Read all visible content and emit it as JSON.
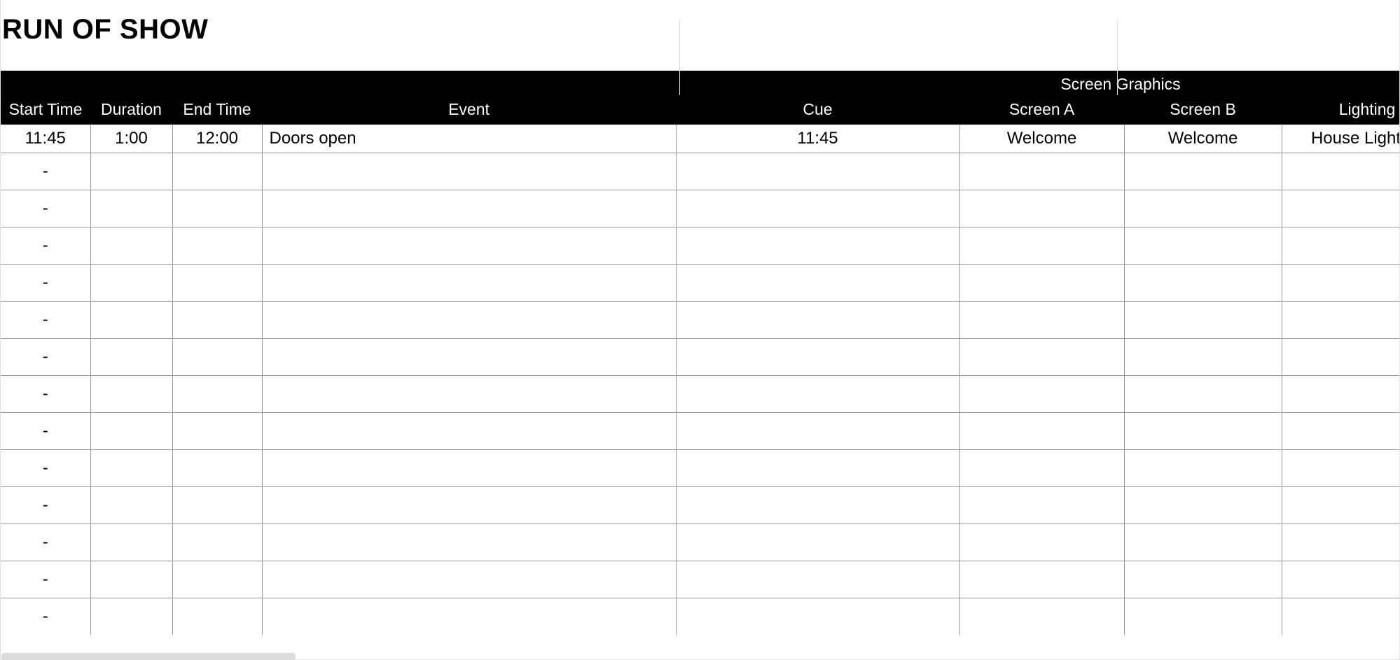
{
  "title": "RUN OF SHOW",
  "headers": {
    "group_screen_graphics": "Screen Graphics",
    "start_time": "Start Time",
    "duration": "Duration",
    "end_time": "End Time",
    "event": "Event",
    "cue": "Cue",
    "screen_a": "Screen A",
    "screen_b": "Screen B",
    "lighting": "Lighting"
  },
  "rows": [
    {
      "start": "11:45",
      "dur": "1:00",
      "end": "12:00",
      "event": "Doors open",
      "cue": "11:45",
      "scra": "Welcome",
      "scrb": "Welcome",
      "light": "House Lighting"
    },
    {
      "start": "-",
      "dur": "",
      "end": "",
      "event": "",
      "cue": "",
      "scra": "",
      "scrb": "",
      "light": ""
    },
    {
      "start": "-",
      "dur": "",
      "end": "",
      "event": "",
      "cue": "",
      "scra": "",
      "scrb": "",
      "light": ""
    },
    {
      "start": "-",
      "dur": "",
      "end": "",
      "event": "",
      "cue": "",
      "scra": "",
      "scrb": "",
      "light": ""
    },
    {
      "start": "-",
      "dur": "",
      "end": "",
      "event": "",
      "cue": "",
      "scra": "",
      "scrb": "",
      "light": ""
    },
    {
      "start": "-",
      "dur": "",
      "end": "",
      "event": "",
      "cue": "",
      "scra": "",
      "scrb": "",
      "light": ""
    },
    {
      "start": "-",
      "dur": "",
      "end": "",
      "event": "",
      "cue": "",
      "scra": "",
      "scrb": "",
      "light": ""
    },
    {
      "start": "-",
      "dur": "",
      "end": "",
      "event": "",
      "cue": "",
      "scra": "",
      "scrb": "",
      "light": ""
    },
    {
      "start": "-",
      "dur": "",
      "end": "",
      "event": "",
      "cue": "",
      "scra": "",
      "scrb": "",
      "light": ""
    },
    {
      "start": "-",
      "dur": "",
      "end": "",
      "event": "",
      "cue": "",
      "scra": "",
      "scrb": "",
      "light": ""
    },
    {
      "start": "-",
      "dur": "",
      "end": "",
      "event": "",
      "cue": "",
      "scra": "",
      "scrb": "",
      "light": ""
    },
    {
      "start": "-",
      "dur": "",
      "end": "",
      "event": "",
      "cue": "",
      "scra": "",
      "scrb": "",
      "light": ""
    },
    {
      "start": "-",
      "dur": "",
      "end": "",
      "event": "",
      "cue": "",
      "scra": "",
      "scrb": "",
      "light": ""
    },
    {
      "start": "-",
      "dur": "",
      "end": "",
      "event": "",
      "cue": "",
      "scra": "",
      "scrb": "",
      "light": ""
    }
  ]
}
